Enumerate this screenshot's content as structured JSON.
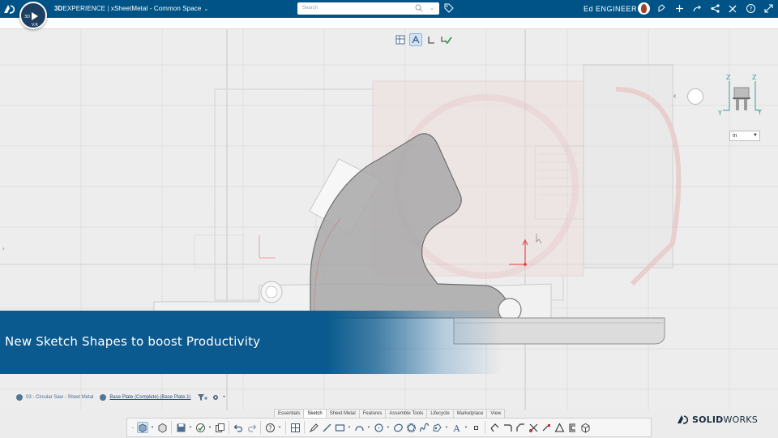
{
  "topbar": {
    "brand_bold": "3D",
    "brand_rest": "EXPERIENCE",
    "separator": "|",
    "app_title": "xSheetMetal - Common Space",
    "search_placeholder": "Search",
    "user_name": "Ed ENGINEER",
    "compass_labels": [
      "3D",
      "V.R"
    ],
    "icons": [
      "share-icon",
      "add-icon",
      "share-network-icon",
      "tools-icon",
      "help-icon",
      "expand-icon"
    ]
  },
  "viewport": {
    "units": "in",
    "triad_labels": [
      "Z",
      "Z",
      "Y",
      "Y"
    ]
  },
  "banner": {
    "text": "New Sketch Shapes to boost Productivity"
  },
  "breadcrumb": {
    "root": "03 - Circular Saw - Sheet Metal",
    "current": "Base Plate (Complete) (Base Plate.1)"
  },
  "tabs": [
    "Essentials",
    "Sketch",
    "Sheet Metal",
    "Features",
    "Assemble Tools",
    "Lifecycle",
    "Marketplace",
    "View"
  ],
  "active_tab": "Sketch",
  "brand_footer": {
    "bold": "SOLID",
    "rest": "WORKS"
  },
  "colors": {
    "header": "#005386",
    "banner": "#0a5a8f",
    "sketch_axis": "#e03a3a"
  }
}
